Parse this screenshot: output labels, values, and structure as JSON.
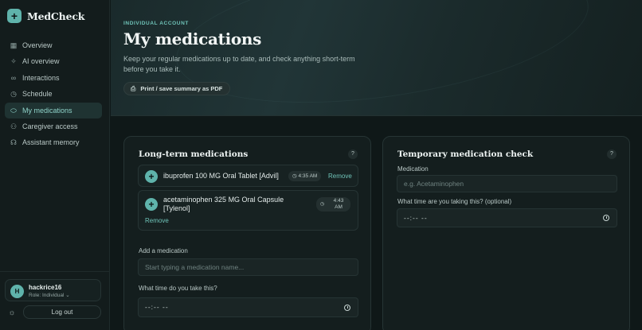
{
  "sidebar": {
    "brand": "MedCheck",
    "items": [
      {
        "label": "Overview",
        "icon": "grid-icon"
      },
      {
        "label": "AI overview",
        "icon": "sparkle-icon"
      },
      {
        "label": "Interactions",
        "icon": "link-icon"
      },
      {
        "label": "Schedule",
        "icon": "clock-icon"
      },
      {
        "label": "My medications",
        "icon": "pill-icon",
        "active": true
      },
      {
        "label": "Caregiver access",
        "icon": "users-icon"
      },
      {
        "label": "Assistant memory",
        "icon": "brain-icon"
      }
    ],
    "user": {
      "initial": "H",
      "name": "hackrice16",
      "role": "Role: Individual ⌄"
    },
    "logout": "Log out"
  },
  "header": {
    "kicker": "INDIVIDUAL ACCOUNT",
    "title": "My medications",
    "subtitle": "Keep your regular medications up to date, and check anything short-term before you take it.",
    "print_button": "Print / save summary as PDF"
  },
  "long_term": {
    "title": "Long-term medications",
    "help": "?",
    "meds": [
      {
        "name": "ibuprofen 100 MG Oral Tablet [Advil]",
        "time": "4:35 AM",
        "remove": "Remove"
      },
      {
        "name": "acetaminophen 325 MG Oral Capsule [Tylenol]",
        "time": "4:43 AM",
        "remove": "Remove"
      }
    ],
    "add_label": "Add a medication",
    "add_placeholder": "Start typing a medication name...",
    "time_label": "What time do you take this?",
    "time_value": "--:-- --"
  },
  "temporary": {
    "title": "Temporary medication check",
    "help": "?",
    "med_label": "Medication",
    "med_placeholder": "e.g. Acetaminophen",
    "time_label": "What time are you taking this? (optional)",
    "time_value": "--:-- --"
  },
  "colors": {
    "accent": "#5fb3ab",
    "background": "#0f1818"
  }
}
